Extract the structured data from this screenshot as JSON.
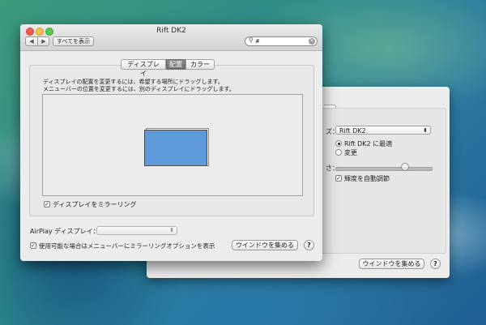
{
  "back_window": {
    "tab_fragment": "ー",
    "display_label_fragment": "ズ：",
    "display_select": "Rift DK2",
    "radio_best": "Rift DK2 に最適",
    "radio_change": "変更",
    "brightness_label_fragment": "さ：",
    "brightness_value": 0.73,
    "auto_brightness": "輝度を自動調節",
    "gather_button": "ウインドウを集める",
    "help": "?"
  },
  "front_window": {
    "title": "Rift DK2",
    "nav_back": "◀",
    "nav_fwd": "▶",
    "show_all": "すべてを表示",
    "search_value": "#",
    "tabs": [
      {
        "label": "ディスプレイ",
        "selected": false
      },
      {
        "label": "配置",
        "selected": true
      },
      {
        "label": "カラー",
        "selected": false
      }
    ],
    "info_line1": "ディスプレイの配置を変更するには、希望する場所にドラッグします。",
    "info_line2": "メニューバーの位置を変更するには、別のディスプレイにドラッグします。",
    "mirror_label": "ディスプレイをミラーリング",
    "airplay_label": "AirPlay ディスプレイ：",
    "airplay_value": "",
    "show_options_label": "使用可能な場合はメニューバーにミラーリングオプションを表示",
    "gather_button": "ウインドウを集める",
    "help": "?"
  },
  "colors": {
    "monitor_fill": "#5e9ad9",
    "selected_tab": "#7c7c7c"
  }
}
